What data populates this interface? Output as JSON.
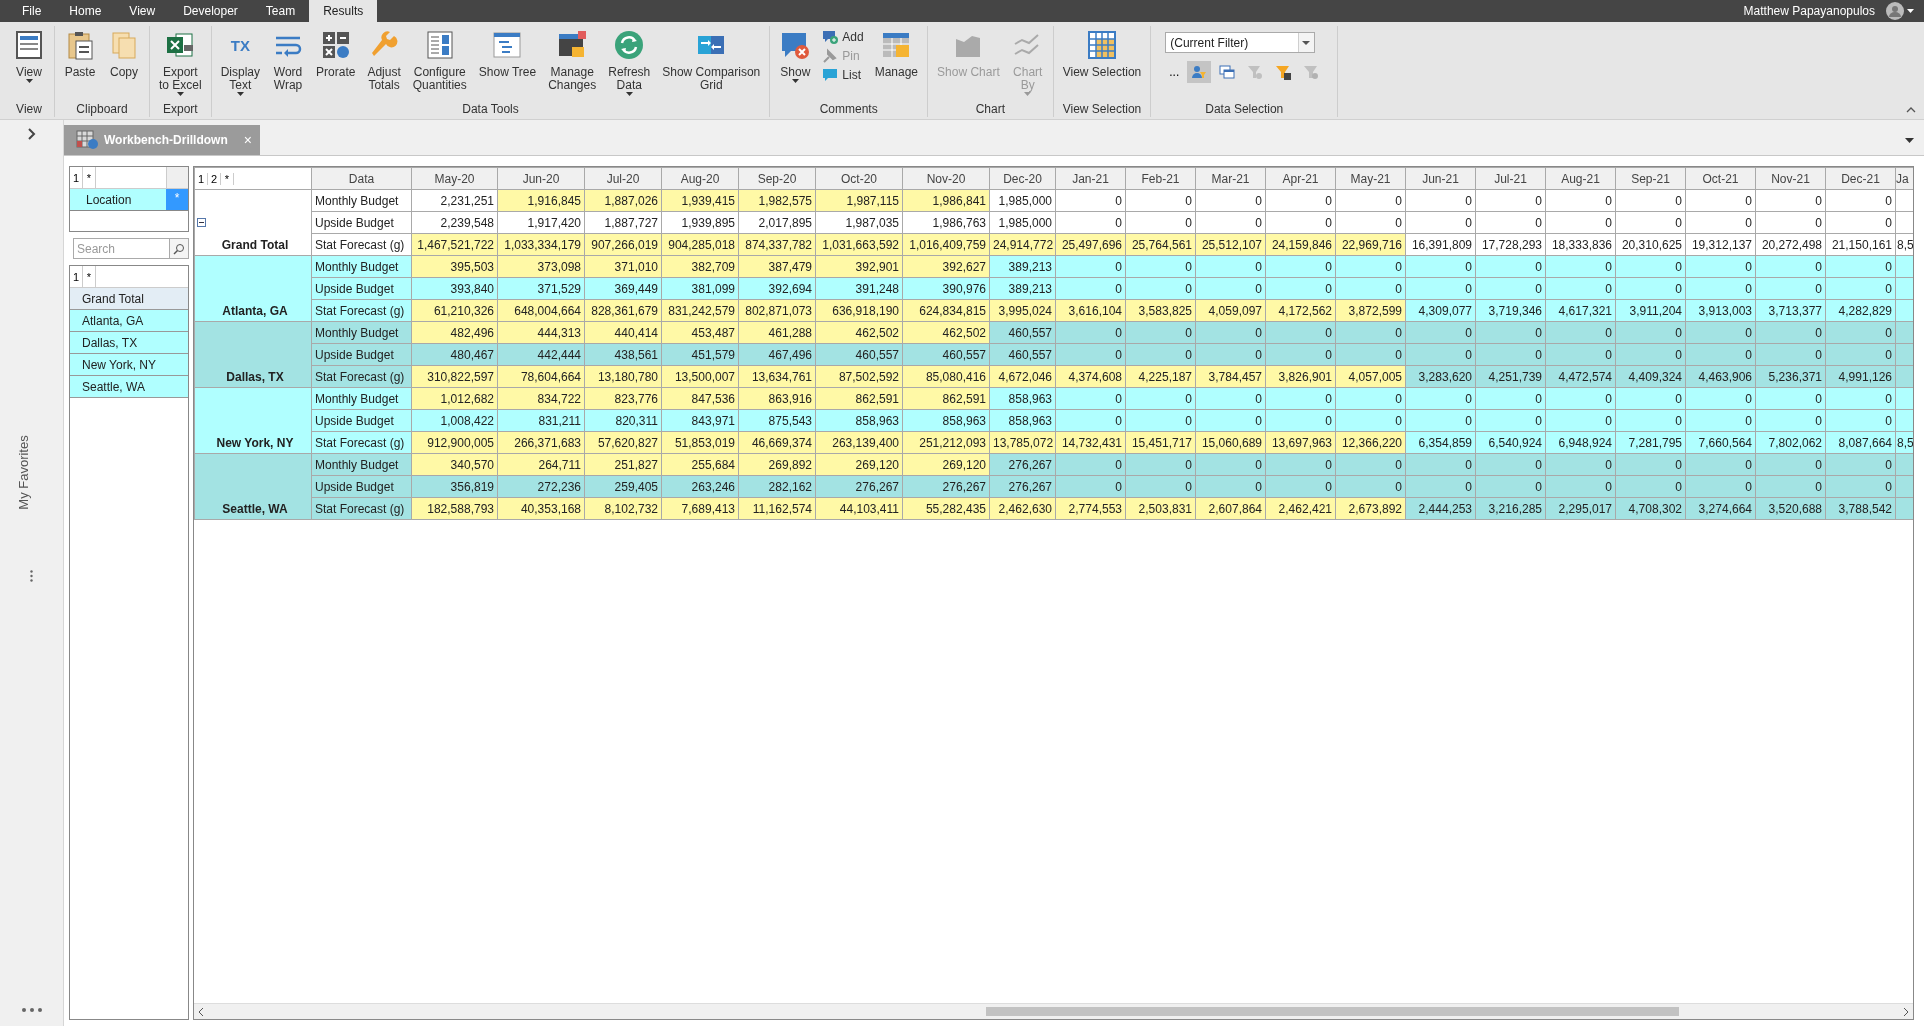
{
  "menu": {
    "tabs": [
      {
        "label": "File",
        "selected": false
      },
      {
        "label": "Home",
        "selected": false
      },
      {
        "label": "View",
        "selected": false
      },
      {
        "label": "Developer",
        "selected": false
      },
      {
        "label": "Team",
        "selected": false
      },
      {
        "label": "Results",
        "selected": true
      }
    ],
    "user": "Matthew Papayanopulos"
  },
  "ribbon": {
    "groups": [
      {
        "label": "View",
        "items": [
          {
            "kind": "large",
            "lines": [
              "View"
            ],
            "dropdown": true,
            "disabled": false
          }
        ]
      },
      {
        "label": "Clipboard",
        "items": [
          {
            "kind": "large",
            "lines": [
              "Paste"
            ],
            "dropdown": false,
            "disabled": false
          },
          {
            "kind": "large",
            "lines": [
              "Copy"
            ],
            "dropdown": false,
            "disabled": false
          }
        ]
      },
      {
        "label": "Export",
        "items": [
          {
            "kind": "large",
            "lines": [
              "Export",
              "to Excel"
            ],
            "dropdown": true,
            "disabled": false
          }
        ]
      },
      {
        "label": "Data Tools",
        "items": [
          {
            "kind": "large",
            "lines": [
              "Display",
              "Text"
            ],
            "icon_text": "TX",
            "dropdown": true,
            "disabled": false
          },
          {
            "kind": "large",
            "lines": [
              "Word",
              "Wrap"
            ],
            "dropdown": false,
            "disabled": false
          },
          {
            "kind": "large",
            "lines": [
              "Prorate"
            ],
            "dropdown": false,
            "disabled": false
          },
          {
            "kind": "large",
            "lines": [
              "Adjust",
              "Totals"
            ],
            "dropdown": false,
            "disabled": false
          },
          {
            "kind": "large",
            "lines": [
              "Configure",
              "Quantities"
            ],
            "dropdown": false,
            "disabled": false
          },
          {
            "kind": "large",
            "lines": [
              "Show Tree"
            ],
            "dropdown": false,
            "disabled": false
          },
          {
            "kind": "large",
            "lines": [
              "Manage",
              "Changes"
            ],
            "dropdown": false,
            "disabled": false
          },
          {
            "kind": "large",
            "lines": [
              "Refresh",
              "Data"
            ],
            "dropdown": true,
            "disabled": false
          },
          {
            "kind": "large",
            "lines": [
              "Show Comparison",
              "Grid"
            ],
            "dropdown": false,
            "disabled": false
          }
        ]
      },
      {
        "label": "Comments",
        "items": [
          {
            "kind": "large",
            "lines": [
              "Show"
            ],
            "dropdown": true,
            "disabled": false
          },
          {
            "kind": "stack",
            "items": [
              {
                "label": "Add",
                "disabled": false
              },
              {
                "label": "Pin",
                "disabled": true
              },
              {
                "label": "List",
                "disabled": false
              }
            ]
          },
          {
            "kind": "large",
            "lines": [
              "Manage"
            ],
            "dropdown": false,
            "disabled": false
          }
        ]
      },
      {
        "label": "Chart",
        "items": [
          {
            "kind": "large",
            "lines": [
              "Show Chart"
            ],
            "dropdown": false,
            "disabled": true
          },
          {
            "kind": "large",
            "lines": [
              "Chart",
              "By"
            ],
            "dropdown": true,
            "disabled": true
          }
        ]
      },
      {
        "label": "View Selection",
        "items": [
          {
            "kind": "large",
            "lines": [
              "View Selection"
            ],
            "dropdown": false,
            "disabled": false
          }
        ]
      },
      {
        "label": "Data Selection",
        "items": [
          {
            "kind": "filter",
            "value": "(Current Filter)",
            "more": "...",
            "tools": [
              {
                "selected": true,
                "disabled": false
              },
              {
                "selected": false,
                "disabled": false
              },
              {
                "selected": false,
                "disabled": true
              },
              {
                "selected": false,
                "disabled": false
              },
              {
                "selected": false,
                "disabled": true
              }
            ]
          }
        ]
      }
    ]
  },
  "rail": {
    "label": "My Favorites"
  },
  "doc_tab": {
    "title": "Workbench-Drilldown",
    "close": "×"
  },
  "pivot": {
    "levels": [
      "1",
      "*"
    ],
    "field": "Location",
    "field_marker": "*"
  },
  "search": {
    "placeholder": "Search"
  },
  "member_list": {
    "levels": [
      "1",
      "*"
    ],
    "items": [
      {
        "label": "Grand Total",
        "selected": true
      },
      {
        "label": "Atlanta, GA",
        "selected": false
      },
      {
        "label": "Dallas, TX",
        "selected": false
      },
      {
        "label": "New York, NY",
        "selected": false
      },
      {
        "label": "Seattle, WA",
        "selected": false
      }
    ]
  },
  "grid": {
    "levels": [
      "1",
      "2",
      "*"
    ],
    "data_heading": "Data",
    "columns": [
      "May-20",
      "Jun-20",
      "Jul-20",
      "Aug-20",
      "Sep-20",
      "Oct-20",
      "Nov-20",
      "Dec-20",
      "Jan-21",
      "Feb-21",
      "Mar-21",
      "Apr-21",
      "May-21",
      "Jun-21",
      "Jul-21",
      "Aug-21",
      "Sep-21",
      "Oct-21",
      "Nov-21",
      "Dec-21",
      "Ja"
    ],
    "groups": [
      {
        "kind": "total",
        "name": "Grand Total",
        "expanded": true,
        "rows": [
          {
            "label": "Monthly Budget",
            "values": [
              "2,231,251",
              "1,916,845",
              "1,887,026",
              "1,939,415",
              "1,982,575",
              "1,987,115",
              "1,986,841",
              "1,985,000",
              "0",
              "0",
              "0",
              "0",
              "0",
              "0",
              "0",
              "0",
              "0",
              "0",
              "0",
              "0"
            ],
            "highlighted": [
              false,
              true,
              true,
              true,
              true,
              true,
              true,
              false,
              false,
              false,
              false,
              false,
              false,
              false,
              false,
              false,
              false,
              false,
              false,
              false
            ]
          },
          {
            "label": "Upside Budget",
            "values": [
              "2,239,548",
              "1,917,420",
              "1,887,727",
              "1,939,895",
              "2,017,895",
              "1,987,035",
              "1,986,763",
              "1,985,000",
              "0",
              "0",
              "0",
              "0",
              "0",
              "0",
              "0",
              "0",
              "0",
              "0",
              "0",
              "0"
            ],
            "highlighted": [
              false,
              false,
              false,
              false,
              false,
              false,
              false,
              false,
              false,
              false,
              false,
              false,
              false,
              false,
              false,
              false,
              false,
              false,
              false,
              false
            ]
          },
          {
            "label": "Stat Forecast (g)",
            "values": [
              "1,467,521,722",
              "1,033,334,179",
              "907,266,019",
              "904,285,018",
              "874,337,782",
              "1,031,663,592",
              "1,016,409,759",
              "24,914,772",
              "25,497,696",
              "25,764,561",
              "25,512,107",
              "24,159,846",
              "22,969,716",
              "16,391,809",
              "17,728,293",
              "18,333,836",
              "20,310,625",
              "19,312,137",
              "20,272,498",
              "21,150,161",
              "8,5"
            ],
            "highlighted": [
              true,
              true,
              true,
              true,
              true,
              true,
              true,
              true,
              true,
              true,
              true,
              true,
              true,
              false,
              false,
              false,
              false,
              false,
              false,
              false,
              false
            ]
          }
        ]
      },
      {
        "kind": "location",
        "name": "Atlanta, GA",
        "rows": [
          {
            "label": "Monthly Budget",
            "values": [
              "395,503",
              "373,098",
              "371,010",
              "382,709",
              "387,479",
              "392,901",
              "392,627",
              "389,213",
              "0",
              "0",
              "0",
              "0",
              "0",
              "0",
              "0",
              "0",
              "0",
              "0",
              "0",
              "0"
            ],
            "highlighted": [
              true,
              true,
              true,
              true,
              true,
              true,
              true,
              false,
              false,
              false,
              false,
              false,
              false,
              false,
              false,
              false,
              false,
              false,
              false,
              false
            ]
          },
          {
            "label": "Upside Budget",
            "values": [
              "393,840",
              "371,529",
              "369,449",
              "381,099",
              "392,694",
              "391,248",
              "390,976",
              "389,213",
              "0",
              "0",
              "0",
              "0",
              "0",
              "0",
              "0",
              "0",
              "0",
              "0",
              "0",
              "0"
            ],
            "highlighted": [
              false,
              false,
              false,
              false,
              false,
              false,
              false,
              false,
              false,
              false,
              false,
              false,
              false,
              false,
              false,
              false,
              false,
              false,
              false,
              false
            ]
          },
          {
            "label": "Stat Forecast (g)",
            "values": [
              "61,210,326",
              "648,004,664",
              "828,361,679",
              "831,242,579",
              "802,871,073",
              "636,918,190",
              "624,834,815",
              "3,995,024",
              "3,616,104",
              "3,583,825",
              "4,059,097",
              "4,172,562",
              "3,872,599",
              "4,309,077",
              "3,719,346",
              "4,617,321",
              "3,911,204",
              "3,913,003",
              "3,713,377",
              "4,282,829"
            ],
            "highlighted": [
              true,
              true,
              true,
              true,
              true,
              true,
              true,
              true,
              true,
              true,
              true,
              true,
              true,
              false,
              false,
              false,
              false,
              false,
              false,
              false
            ]
          }
        ]
      },
      {
        "kind": "location",
        "name": "Dallas, TX",
        "rows": [
          {
            "label": "Monthly Budget",
            "values": [
              "482,496",
              "444,313",
              "440,414",
              "453,487",
              "461,288",
              "462,502",
              "462,502",
              "460,557",
              "0",
              "0",
              "0",
              "0",
              "0",
              "0",
              "0",
              "0",
              "0",
              "0",
              "0",
              "0"
            ],
            "highlighted": [
              true,
              true,
              true,
              true,
              true,
              true,
              true,
              false,
              false,
              false,
              false,
              false,
              false,
              false,
              false,
              false,
              false,
              false,
              false,
              false
            ]
          },
          {
            "label": "Upside Budget",
            "values": [
              "480,467",
              "442,444",
              "438,561",
              "451,579",
              "467,496",
              "460,557",
              "460,557",
              "460,557",
              "0",
              "0",
              "0",
              "0",
              "0",
              "0",
              "0",
              "0",
              "0",
              "0",
              "0",
              "0"
            ],
            "highlighted": [
              false,
              false,
              false,
              false,
              false,
              false,
              false,
              false,
              false,
              false,
              false,
              false,
              false,
              false,
              false,
              false,
              false,
              false,
              false,
              false
            ]
          },
          {
            "label": "Stat Forecast (g)",
            "values": [
              "310,822,597",
              "78,604,664",
              "13,180,780",
              "13,500,007",
              "13,634,761",
              "87,502,592",
              "85,080,416",
              "4,672,046",
              "4,374,608",
              "4,225,187",
              "3,784,457",
              "3,826,901",
              "4,057,005",
              "3,283,620",
              "4,251,739",
              "4,472,574",
              "4,409,324",
              "4,463,906",
              "5,236,371",
              "4,991,126"
            ],
            "highlighted": [
              true,
              true,
              true,
              true,
              true,
              true,
              true,
              true,
              true,
              true,
              true,
              true,
              true,
              false,
              false,
              false,
              false,
              false,
              false,
              false
            ]
          }
        ]
      },
      {
        "kind": "location",
        "name": "New York, NY",
        "rows": [
          {
            "label": "Monthly Budget",
            "values": [
              "1,012,682",
              "834,722",
              "823,776",
              "847,536",
              "863,916",
              "862,591",
              "862,591",
              "858,963",
              "0",
              "0",
              "0",
              "0",
              "0",
              "0",
              "0",
              "0",
              "0",
              "0",
              "0",
              "0"
            ],
            "highlighted": [
              true,
              true,
              true,
              true,
              true,
              true,
              true,
              false,
              false,
              false,
              false,
              false,
              false,
              false,
              false,
              false,
              false,
              false,
              false,
              false
            ]
          },
          {
            "label": "Upside Budget",
            "values": [
              "1,008,422",
              "831,211",
              "820,311",
              "843,971",
              "875,543",
              "858,963",
              "858,963",
              "858,963",
              "0",
              "0",
              "0",
              "0",
              "0",
              "0",
              "0",
              "0",
              "0",
              "0",
              "0",
              "0"
            ],
            "highlighted": [
              false,
              false,
              false,
              false,
              false,
              false,
              false,
              false,
              false,
              false,
              false,
              false,
              false,
              false,
              false,
              false,
              false,
              false,
              false,
              false
            ]
          },
          {
            "label": "Stat Forecast (g)",
            "values": [
              "912,900,005",
              "266,371,683",
              "57,620,827",
              "51,853,019",
              "46,669,374",
              "263,139,400",
              "251,212,093",
              "13,785,072",
              "14,732,431",
              "15,451,717",
              "15,060,689",
              "13,697,963",
              "12,366,220",
              "6,354,859",
              "6,540,924",
              "6,948,924",
              "7,281,795",
              "7,660,564",
              "7,802,062",
              "8,087,664",
              "8,5"
            ],
            "highlighted": [
              true,
              true,
              true,
              true,
              true,
              true,
              true,
              true,
              true,
              true,
              true,
              true,
              true,
              false,
              false,
              false,
              false,
              false,
              false,
              false,
              false
            ]
          }
        ]
      },
      {
        "kind": "location",
        "name": "Seattle, WA",
        "rows": [
          {
            "label": "Monthly Budget",
            "values": [
              "340,570",
              "264,711",
              "251,827",
              "255,684",
              "269,892",
              "269,120",
              "269,120",
              "276,267",
              "0",
              "0",
              "0",
              "0",
              "0",
              "0",
              "0",
              "0",
              "0",
              "0",
              "0",
              "0"
            ],
            "highlighted": [
              true,
              true,
              true,
              true,
              true,
              true,
              true,
              false,
              false,
              false,
              false,
              false,
              false,
              false,
              false,
              false,
              false,
              false,
              false,
              false
            ]
          },
          {
            "label": "Upside Budget",
            "values": [
              "356,819",
              "272,236",
              "259,405",
              "263,246",
              "282,162",
              "276,267",
              "276,267",
              "276,267",
              "0",
              "0",
              "0",
              "0",
              "0",
              "0",
              "0",
              "0",
              "0",
              "0",
              "0",
              "0"
            ],
            "highlighted": [
              false,
              false,
              false,
              false,
              false,
              false,
              false,
              false,
              false,
              false,
              false,
              false,
              false,
              false,
              false,
              false,
              false,
              false,
              false,
              false
            ]
          },
          {
            "label": "Stat Forecast (g)",
            "values": [
              "182,588,793",
              "40,353,168",
              "8,102,732",
              "7,689,413",
              "11,162,574",
              "44,103,411",
              "55,282,435",
              "2,462,630",
              "2,774,553",
              "2,503,831",
              "2,607,864",
              "2,462,421",
              "2,673,892",
              "2,444,253",
              "3,216,285",
              "2,295,017",
              "4,708,302",
              "3,274,664",
              "3,520,688",
              "3,788,542"
            ],
            "highlighted": [
              true,
              true,
              true,
              true,
              true,
              true,
              true,
              true,
              true,
              true,
              true,
              true,
              true,
              false,
              false,
              false,
              false,
              false,
              false,
              false
            ]
          }
        ]
      }
    ]
  }
}
